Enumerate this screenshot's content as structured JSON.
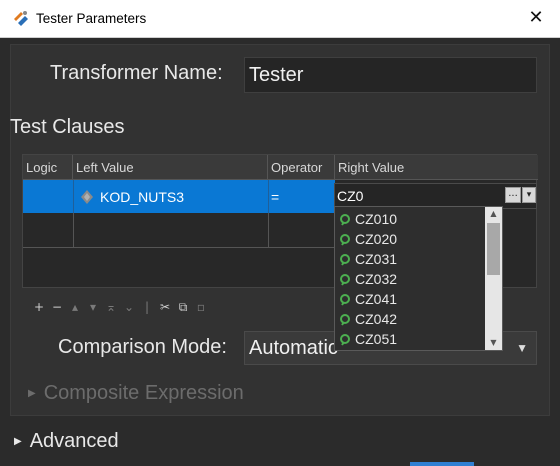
{
  "window": {
    "title": "Tester Parameters",
    "app_icon": "tester-icon",
    "close_icon": "close-icon"
  },
  "form": {
    "transformer_name_label": "Transformer Name:",
    "transformer_name_value": "Tester",
    "test_clauses_heading": "Test Clauses",
    "comparison_mode_label": "Comparison Mode:",
    "comparison_mode_value": "Automatic",
    "composite_expression_label": "Composite Expression",
    "advanced_label": "Advanced"
  },
  "grid": {
    "headers": [
      "Logic",
      "Left Value",
      "Operator",
      "Right Value"
    ],
    "row": {
      "logic": "",
      "left_value": "KOD_NUTS3",
      "operator": "=",
      "right_value": "CZ0"
    },
    "right_value_buttons": {
      "ellipsis": "...",
      "dropdown": "▾"
    }
  },
  "autocomplete": {
    "items": [
      "CZ010",
      "CZ020",
      "CZ031",
      "CZ032",
      "CZ041",
      "CZ042",
      "CZ051"
    ]
  },
  "toolbar": {
    "add": "+",
    "remove": "−",
    "move_up": "▴",
    "move_down": "▾",
    "move_top": "⌅",
    "move_bottom": "⌄",
    "sep": "|",
    "cut": "✂",
    "copy": "⧉",
    "paste": "▫"
  },
  "colors": {
    "selection": "#0a78d4",
    "background": "#2b2b2b",
    "panel": "#323232",
    "attribute_icon": "#8a8a8a",
    "suggestion_icon": "#4caf50"
  }
}
